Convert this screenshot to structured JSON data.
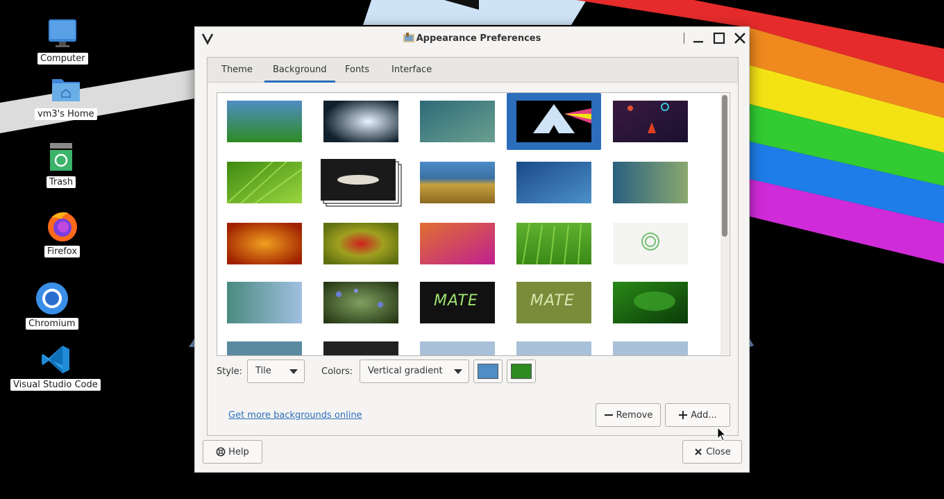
{
  "desktop": {
    "icons": [
      {
        "label": "Computer",
        "icon": "computer-icon"
      },
      {
        "label": "vm3's Home",
        "icon": "home-folder-icon"
      },
      {
        "label": "Trash",
        "icon": "trash-icon"
      },
      {
        "label": "Firefox",
        "icon": "firefox-icon"
      },
      {
        "label": "Chromium",
        "icon": "chromium-icon"
      },
      {
        "label": "Visual Studio Code",
        "icon": "vscode-icon"
      }
    ]
  },
  "window": {
    "title": "Appearance Preferences",
    "tabs": [
      {
        "label": "Theme",
        "active": false
      },
      {
        "label": "Background",
        "active": true
      },
      {
        "label": "Fonts",
        "active": false
      },
      {
        "label": "Interface",
        "active": false
      }
    ],
    "gallery": {
      "selected_index": 3,
      "thumbnails": [
        "green-gradient",
        "water-drop",
        "teal-blur",
        "arch-prism",
        "space-rocket",
        "green-leaf",
        "galaxy-stack",
        "beach-grass",
        "blue-drops",
        "teal-bokeh",
        "orange-flower",
        "red-flower",
        "pink-swirl",
        "green-grass",
        "white-logo",
        "teal-wave",
        "blue-flowers",
        "mate-dark",
        "mate-olive",
        "green-leaves",
        "blue-partial",
        "dark-partial",
        "pattern-partial",
        "pattern-partial",
        "pattern-partial"
      ],
      "mate_text": "MATE"
    },
    "style_label": "Style:",
    "style_value": "Tile",
    "colors_label": "Colors:",
    "colors_value": "Vertical gradient",
    "primary_color": "#4f8dc4",
    "secondary_color": "#2e8b22",
    "more_link": "Get more backgrounds online",
    "remove_label": "Remove",
    "add_label": "Add...",
    "help_label": "Help",
    "close_label": "Close"
  }
}
